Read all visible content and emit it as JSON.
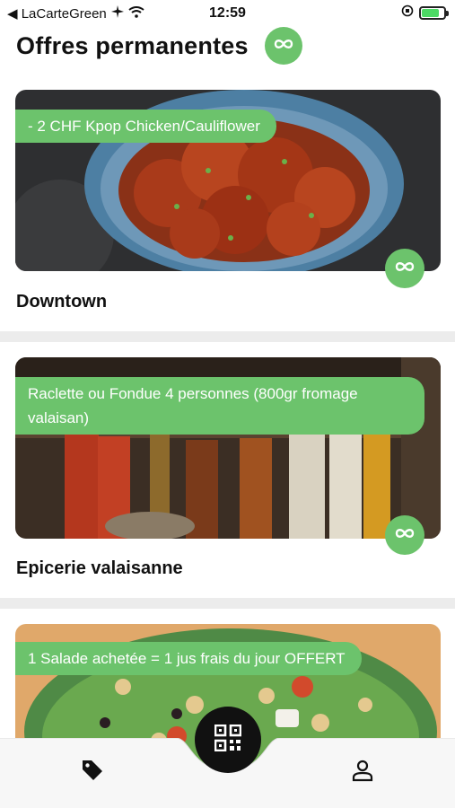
{
  "status_bar": {
    "back_label": "◀ LaCarteGreen",
    "time": "12:59",
    "battery_percent": 80
  },
  "header": {
    "title": "Offres permanentes"
  },
  "offers": [
    {
      "offer": "- 2 CHF Kpop Chicken/Cauliflower",
      "name": "Downtown"
    },
    {
      "offer": "Raclette ou Fondue 4 personnes (800gr fromage valaisan)",
      "name": "Epicerie valaisanne"
    },
    {
      "offer": "1 Salade achetée = 1 jus frais du jour OFFERT",
      "name": ""
    }
  ],
  "colors": {
    "accent_green": "#6cc36c",
    "dark": "#111111",
    "divider": "#ececec"
  },
  "icons": {
    "infinity": "infinity-icon",
    "tag": "tag-icon",
    "qr": "qr-code-icon",
    "profile": "user-icon"
  }
}
